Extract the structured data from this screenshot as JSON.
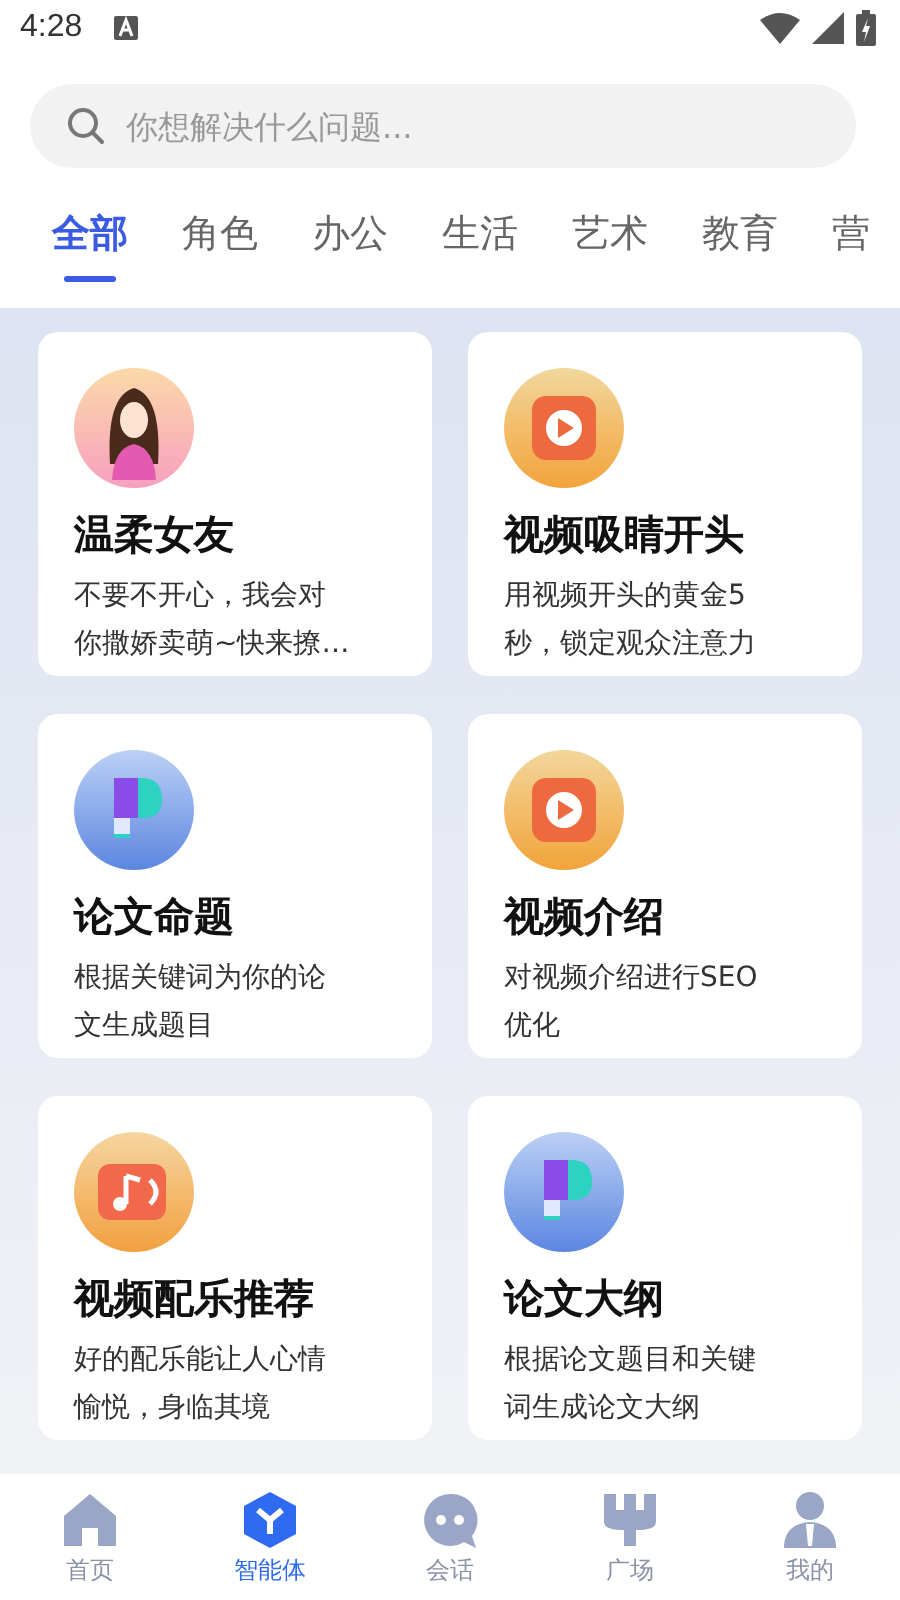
{
  "status_bar": {
    "time": "4:28"
  },
  "search": {
    "placeholder": "你想解决什么问题..."
  },
  "tabs": [
    {
      "label": "全部",
      "selected": true
    },
    {
      "label": "角色",
      "selected": false
    },
    {
      "label": "办公",
      "selected": false
    },
    {
      "label": "生活",
      "selected": false
    },
    {
      "label": "艺术",
      "selected": false
    },
    {
      "label": "教育",
      "selected": false
    },
    {
      "label": "营",
      "selected": false
    }
  ],
  "cards": [
    {
      "kind": "avatar",
      "title": "温柔女友",
      "description": "不要不开心，我会对你撒娇卖萌~快来撩…"
    },
    {
      "kind": "video",
      "title": "视频吸睛开头",
      "description": "用视频开头的黄金5秒，锁定观众注意力"
    },
    {
      "kind": "paper",
      "title": "论文命题",
      "description": "根据关键词为你的论文生成题目"
    },
    {
      "kind": "video",
      "title": "视频介绍",
      "description": "对视频介绍进行SEO优化"
    },
    {
      "kind": "music",
      "title": "视频配乐推荐",
      "description": "好的配乐能让人心情愉悦，身临其境"
    },
    {
      "kind": "paper",
      "title": "论文大纲",
      "description": "根据论文题目和关键词生成论文大纲"
    }
  ],
  "bottom_nav": [
    {
      "kind": "home",
      "label": "首页",
      "selected": false
    },
    {
      "kind": "agent",
      "label": "智能体",
      "selected": true
    },
    {
      "kind": "chat",
      "label": "会话",
      "selected": false
    },
    {
      "kind": "plaza",
      "label": "广场",
      "selected": false
    },
    {
      "kind": "user",
      "label": "我的",
      "selected": false
    }
  ]
}
